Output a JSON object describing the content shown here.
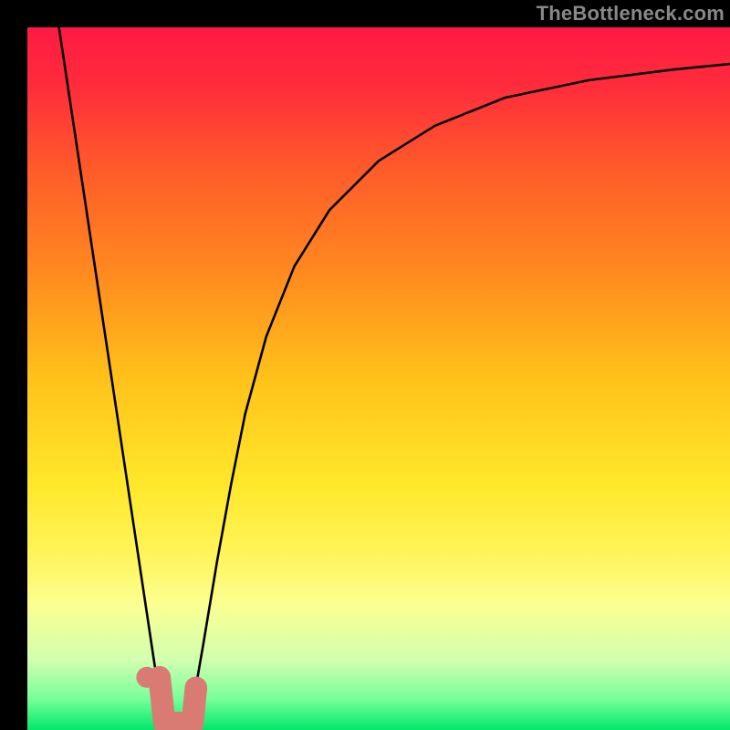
{
  "watermark": "TheBottleneck.com",
  "chart_data": {
    "type": "line",
    "title": "",
    "xlabel": "",
    "ylabel": "",
    "xlim": [
      0,
      100
    ],
    "ylim": [
      0,
      100
    ],
    "grid": false,
    "legend": false,
    "gradient_stops": [
      {
        "offset": 0.0,
        "color": "#ff1a44"
      },
      {
        "offset": 0.08,
        "color": "#ff2b3c"
      },
      {
        "offset": 0.2,
        "color": "#ff5a2a"
      },
      {
        "offset": 0.35,
        "color": "#ff8a1f"
      },
      {
        "offset": 0.5,
        "color": "#ffc21a"
      },
      {
        "offset": 0.65,
        "color": "#ffe82a"
      },
      {
        "offset": 0.75,
        "color": "#fff45a"
      },
      {
        "offset": 0.82,
        "color": "#fcff90"
      },
      {
        "offset": 0.9,
        "color": "#d2ffb0"
      },
      {
        "offset": 0.955,
        "color": "#7aff9a"
      },
      {
        "offset": 1.0,
        "color": "#00e86a"
      }
    ],
    "series": [
      {
        "name": "curve-left",
        "stroke": "#000000",
        "values": [
          {
            "x": 4.5,
            "y": 100.0
          },
          {
            "x": 6.0,
            "y": 90.0
          },
          {
            "x": 7.5,
            "y": 80.0
          },
          {
            "x": 9.0,
            "y": 70.0
          },
          {
            "x": 10.5,
            "y": 60.0
          },
          {
            "x": 12.0,
            "y": 50.0
          },
          {
            "x": 13.5,
            "y": 40.0
          },
          {
            "x": 15.0,
            "y": 30.0
          },
          {
            "x": 16.5,
            "y": 20.0
          },
          {
            "x": 18.0,
            "y": 10.0
          },
          {
            "x": 19.5,
            "y": 0.5
          }
        ]
      },
      {
        "name": "curve-right",
        "stroke": "#000000",
        "values": [
          {
            "x": 23.0,
            "y": 0.5
          },
          {
            "x": 25.0,
            "y": 12.0
          },
          {
            "x": 27.0,
            "y": 24.0
          },
          {
            "x": 29.0,
            "y": 35.0
          },
          {
            "x": 31.0,
            "y": 45.0
          },
          {
            "x": 34.0,
            "y": 56.0
          },
          {
            "x": 38.0,
            "y": 66.0
          },
          {
            "x": 43.0,
            "y": 74.0
          },
          {
            "x": 50.0,
            "y": 81.0
          },
          {
            "x": 58.0,
            "y": 86.0
          },
          {
            "x": 68.0,
            "y": 90.0
          },
          {
            "x": 80.0,
            "y": 92.5
          },
          {
            "x": 92.0,
            "y": 94.0
          },
          {
            "x": 100.0,
            "y": 94.8
          }
        ]
      }
    ],
    "markers": [
      {
        "name": "dot",
        "shape": "circle",
        "cx": 17.0,
        "cy": 7.5,
        "r": 1.5,
        "fill": "#d97b72"
      },
      {
        "name": "hook",
        "shape": "path",
        "stroke": "#d97b72",
        "stroke_width": 3.2,
        "points": [
          {
            "x": 18.8,
            "y": 7.5
          },
          {
            "x": 19.5,
            "y": 1.0
          },
          {
            "x": 23.5,
            "y": 1.0
          },
          {
            "x": 24.0,
            "y": 6.0
          }
        ]
      }
    ]
  }
}
